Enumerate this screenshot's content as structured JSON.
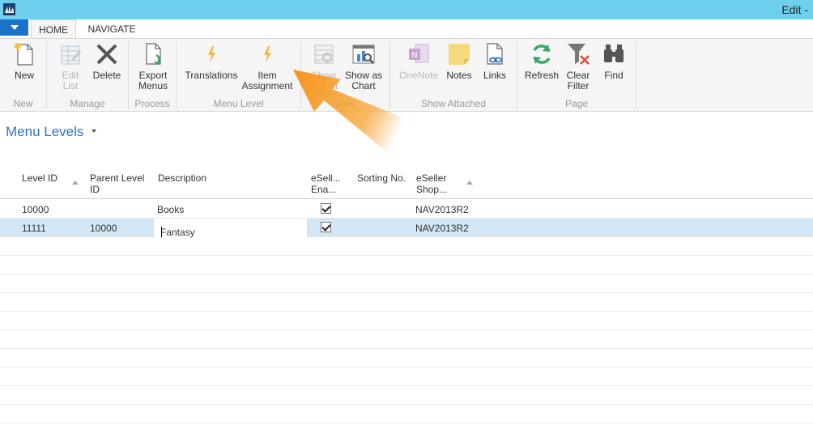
{
  "window": {
    "title_right": "Edit -"
  },
  "ribbon_tabs": [
    {
      "label": "HOME",
      "active": true
    },
    {
      "label": "NAVIGATE",
      "active": false
    }
  ],
  "ribbon": {
    "groups": {
      "new": "New",
      "manage": "Manage",
      "process": "Process",
      "menu_level": "Menu Level",
      "view": "View",
      "show_attached": "Show Attached",
      "page": "Page"
    },
    "buttons": {
      "new": {
        "line1": "New",
        "line2": "",
        "icon": "new-document-icon"
      },
      "edit_list": {
        "line1": "Edit",
        "line2": "List",
        "icon": "edit-list-icon",
        "disabled": true
      },
      "delete": {
        "line1": "Delete",
        "line2": "",
        "icon": "delete-x-icon"
      },
      "export_menus": {
        "line1": "Export",
        "line2": "Menus",
        "icon": "export-icon"
      },
      "translations": {
        "line1": "Translations",
        "line2": "",
        "icon": "lightning-icon"
      },
      "item_assignment": {
        "line1": "Item",
        "line2": "Assignment",
        "icon": "lightning-icon"
      },
      "show_as_list": {
        "line1": "Show",
        "line2": "as List",
        "icon": "show-as-list-icon",
        "disabled": true
      },
      "show_as_chart": {
        "line1": "Show as",
        "line2": "Chart",
        "icon": "show-as-chart-icon"
      },
      "onenote": {
        "line1": "OneNote",
        "line2": "",
        "icon": "onenote-icon",
        "disabled": true
      },
      "notes": {
        "line1": "Notes",
        "line2": "",
        "icon": "note-icon"
      },
      "links": {
        "line1": "Links",
        "line2": "",
        "icon": "link-icon"
      },
      "refresh": {
        "line1": "Refresh",
        "line2": "",
        "icon": "refresh-icon"
      },
      "clear_filter": {
        "line1": "Clear",
        "line2": "Filter",
        "icon": "clear-filter-icon"
      },
      "find": {
        "line1": "Find",
        "line2": "",
        "icon": "binoculars-icon"
      }
    }
  },
  "page": {
    "title": "Menu Levels"
  },
  "table": {
    "columns": {
      "level_id": "Level ID",
      "parent_level_id_1": "Parent Level",
      "parent_level_id_2": "ID",
      "description": "Description",
      "enabled_1": "eSell...",
      "enabled_2": "Ena...",
      "sorting_no": "Sorting No.",
      "shop_1": "eSeller",
      "shop_2": "Shop..."
    },
    "rows": [
      {
        "level_id": "10000",
        "parent_level_id": "",
        "description": "Books",
        "enabled": true,
        "sorting_no": "",
        "shop": "NAV2013R2",
        "selected": false
      },
      {
        "level_id": "11111",
        "parent_level_id": "10000",
        "description": "Fantasy",
        "enabled": true,
        "sorting_no": "",
        "shop": "NAV2013R2",
        "selected": true
      }
    ]
  },
  "colors": {
    "titlebar": "#6fd0ee",
    "accent": "#2b76c0",
    "selected_row": "#d2e6f5",
    "annotation_arrow": "#f7941d"
  }
}
